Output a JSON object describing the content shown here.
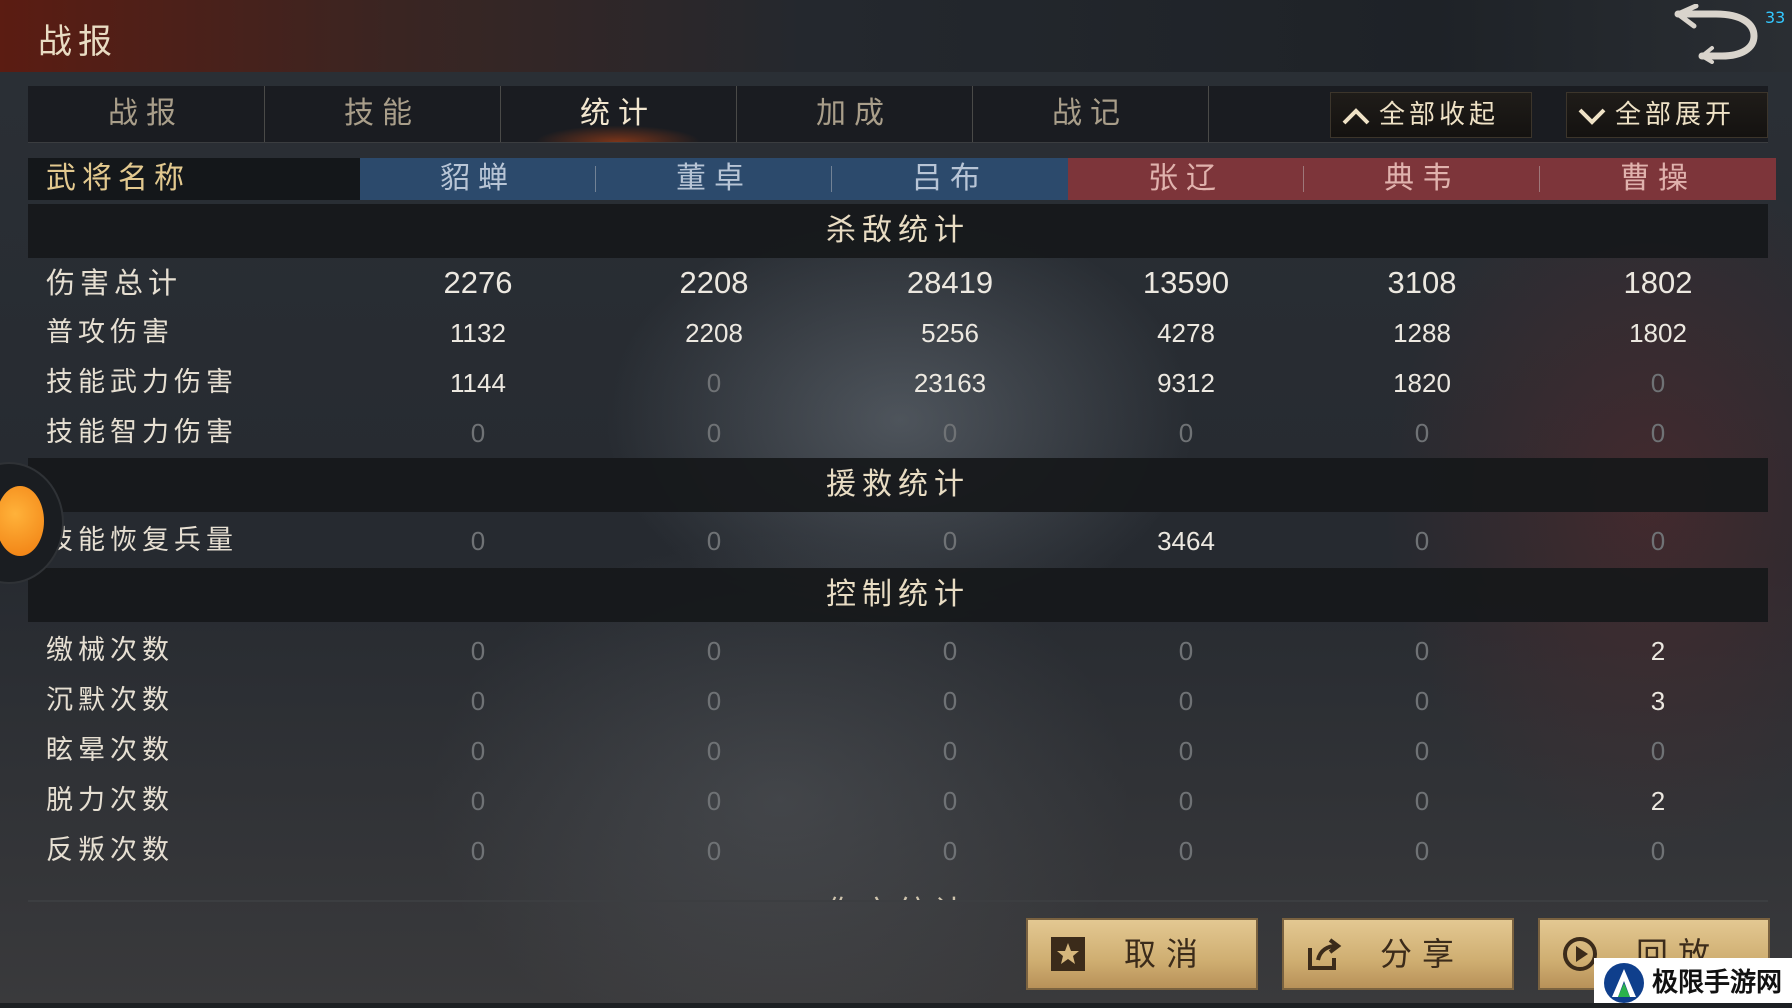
{
  "header": {
    "title": "战报",
    "fps": "33"
  },
  "tabs": [
    {
      "label": "战报",
      "active": false
    },
    {
      "label": "技能",
      "active": false
    },
    {
      "label": "统计",
      "active": true
    },
    {
      "label": "加成",
      "active": false
    },
    {
      "label": "战记",
      "active": false
    }
  ],
  "controls": {
    "collapse_all": "全部收起",
    "expand_all": "全部展开"
  },
  "table": {
    "name_header": "武将名称",
    "generals": [
      {
        "name": "貂蝉",
        "team": "blue"
      },
      {
        "name": "董卓",
        "team": "blue"
      },
      {
        "name": "吕布",
        "team": "blue"
      },
      {
        "name": "张辽",
        "team": "red"
      },
      {
        "name": "典韦",
        "team": "red"
      },
      {
        "name": "曹操",
        "team": "red"
      }
    ],
    "sections": [
      {
        "title": "杀敌统计",
        "rows": [
          {
            "label": "伤害总计",
            "values": [
              "2276",
              "2208",
              "28419",
              "13590",
              "3108",
              "1802"
            ]
          },
          {
            "label": "普攻伤害",
            "values": [
              "1132",
              "2208",
              "5256",
              "4278",
              "1288",
              "1802"
            ]
          },
          {
            "label": "技能武力伤害",
            "values": [
              "1144",
              "0",
              "23163",
              "9312",
              "1820",
              "0"
            ]
          },
          {
            "label": "技能智力伤害",
            "values": [
              "0",
              "0",
              "0",
              "0",
              "0",
              "0"
            ]
          }
        ]
      },
      {
        "title": "援救统计",
        "rows": [
          {
            "label": "技能恢复兵量",
            "values": [
              "0",
              "0",
              "0",
              "3464",
              "0",
              "0"
            ]
          }
        ]
      },
      {
        "title": "控制统计",
        "rows": [
          {
            "label": "缴械次数",
            "values": [
              "0",
              "0",
              "0",
              "0",
              "0",
              "2"
            ]
          },
          {
            "label": "沉默次数",
            "values": [
              "0",
              "0",
              "0",
              "0",
              "0",
              "3"
            ]
          },
          {
            "label": "眩晕次数",
            "values": [
              "0",
              "0",
              "0",
              "0",
              "0",
              "0"
            ]
          },
          {
            "label": "脱力次数",
            "values": [
              "0",
              "0",
              "0",
              "0",
              "0",
              "2"
            ]
          },
          {
            "label": "反叛次数",
            "values": [
              "0",
              "0",
              "0",
              "0",
              "0",
              "0"
            ]
          }
        ]
      }
    ],
    "next_section_partial": "伤亡统计"
  },
  "buttons": {
    "cancel": "取消",
    "share": "分享",
    "replay": "回放"
  },
  "watermark": "极限手游网",
  "colors": {
    "team_blue": "#2c4a6c",
    "team_red": "#7d353a",
    "button_gold": "#d6b77c",
    "fps_cyan": "#33c8ff"
  },
  "icons": [
    "back-arrow-icon",
    "chevron-up-icon",
    "chevron-down-icon",
    "star-icon",
    "share-icon",
    "play-icon"
  ]
}
